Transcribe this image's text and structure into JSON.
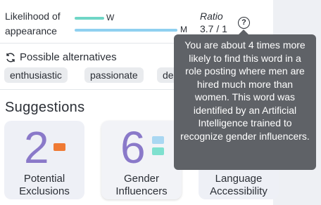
{
  "likelihood": {
    "label": "Likelihood of appearance",
    "women_letter": "W",
    "men_letter": "M",
    "ratio_label": "Ratio",
    "ratio_value": "3.7 / 1"
  },
  "alternatives": {
    "header": "Possible alternatives",
    "chips": [
      "enthusiastic",
      "passionate",
      "de"
    ]
  },
  "suggestions": {
    "title": "Suggestions",
    "cards": [
      {
        "number": "2",
        "label_line1": "Potential",
        "label_line2": "Exclusions"
      },
      {
        "number": "6",
        "label_line1": "Gender",
        "label_line2": "Influencers"
      },
      {
        "number": "",
        "label_line1": "Language",
        "label_line2": "Accessibility"
      }
    ]
  },
  "tooltip": {
    "text": "You are about 4 times more likely to find this word in a role posting where men are hired much more than women. This word was identified by an Artificial Intelligence trained to recognize gender influencers."
  },
  "colors": {
    "women_bar": "#6fd6c6",
    "men_bar": "#8fd0f0",
    "accent_number": "#8a79c9",
    "exclusion_square": "#ef7a34",
    "tooltip_bg": "#5f6267"
  },
  "icons": {
    "refresh": "refresh-icon",
    "help": "help-circle-icon"
  }
}
